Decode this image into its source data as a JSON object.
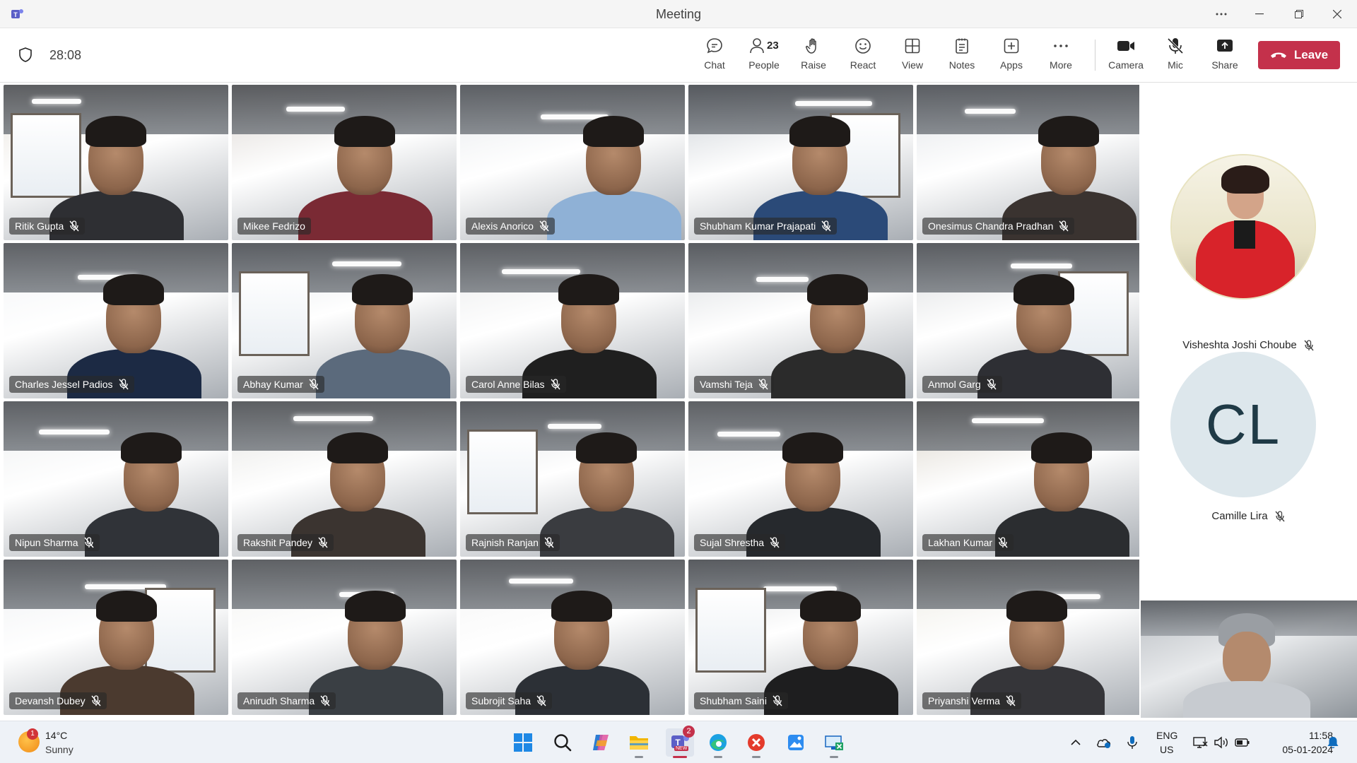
{
  "window": {
    "title": "Meeting"
  },
  "toolbar": {
    "timer": "28:08",
    "buttons": {
      "chat": "Chat",
      "people": "People",
      "people_count": "23",
      "raise": "Raise",
      "react": "React",
      "view": "View",
      "notes": "Notes",
      "apps": "Apps",
      "more": "More",
      "camera": "Camera",
      "mic": "Mic",
      "share": "Share"
    },
    "leave_label": "Leave"
  },
  "participants": [
    {
      "name": "Ritik Gupta",
      "muted": true
    },
    {
      "name": "Mikee Fedrizo",
      "muted": false
    },
    {
      "name": "Alexis Anorico",
      "muted": true
    },
    {
      "name": "Shubham Kumar Prajapati",
      "muted": true
    },
    {
      "name": "Onesimus Chandra Pradhan",
      "muted": true
    },
    {
      "name": "Charles Jessel Padios",
      "muted": true
    },
    {
      "name": "Abhay Kumar",
      "muted": true
    },
    {
      "name": "Carol Anne Bilas",
      "muted": true
    },
    {
      "name": "Vamshi Teja",
      "muted": true
    },
    {
      "name": "Anmol Garg",
      "muted": true
    },
    {
      "name": "Nipun Sharma",
      "muted": true
    },
    {
      "name": "Rakshit Pandey",
      "muted": true
    },
    {
      "name": "Rajnish Ranjan",
      "muted": true
    },
    {
      "name": "Sujal Shrestha",
      "muted": true
    },
    {
      "name": "Lakhan Kumar",
      "muted": true
    },
    {
      "name": "Devansh Dubey",
      "muted": true
    },
    {
      "name": "Anirudh Sharma",
      "muted": true
    },
    {
      "name": "Subrojit Saha",
      "muted": true
    },
    {
      "name": "Shubham Saini",
      "muted": true
    },
    {
      "name": "Priyanshi Verma",
      "muted": true
    }
  ],
  "side_panel": {
    "featured": [
      {
        "name": "Visheshta Joshi Choube",
        "muted": true,
        "type": "photo"
      },
      {
        "name": "Camille Lira",
        "initials": "CL",
        "muted": true,
        "type": "initials"
      }
    ]
  },
  "taskbar": {
    "weather": {
      "temp": "14°C",
      "condition": "Sunny",
      "badge": "1"
    },
    "apps": [
      "start-icon",
      "search-icon",
      "copilot-icon",
      "file-explorer-icon",
      "teams-icon",
      "edge-icon",
      "cross-icon",
      "store-icon",
      "excel-icon"
    ],
    "teams_badge": "2",
    "teams_label": "NEW",
    "lang_line1": "ENG",
    "lang_line2": "US",
    "time": "11:58",
    "date": "05-01-2024"
  },
  "colors": {
    "leave": "#c4314b",
    "accent": "#5b5fc7",
    "nameplate": "rgba(40,40,40,0.62)"
  }
}
